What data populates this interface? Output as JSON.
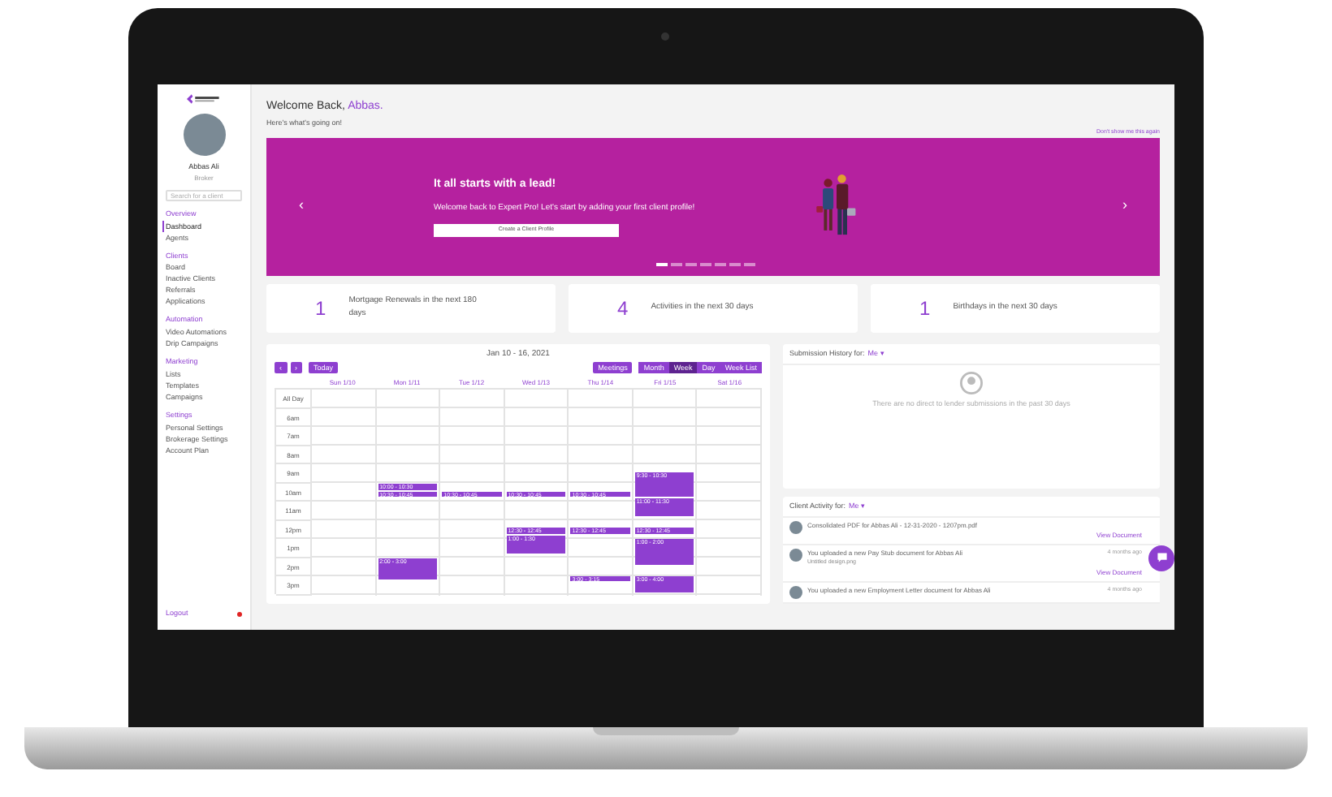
{
  "sidebar": {
    "user": {
      "name": "Abbas Ali",
      "role": "Broker"
    },
    "search": {
      "placeholder": "Search for a client"
    },
    "sections": [
      {
        "title": "Overview",
        "items": [
          {
            "label": "Dashboard",
            "selected": true
          },
          {
            "label": "Agents",
            "selected": false
          }
        ]
      },
      {
        "title": "Clients",
        "items": [
          {
            "label": "Board",
            "selected": false
          },
          {
            "label": "Inactive Clients",
            "selected": false
          },
          {
            "label": "Referrals",
            "selected": false
          },
          {
            "label": "Applications",
            "selected": false
          }
        ]
      },
      {
        "title": "Automation",
        "items": [
          {
            "label": "Video Automations",
            "selected": false
          },
          {
            "label": "Drip Campaigns",
            "selected": false
          }
        ]
      },
      {
        "title": "Marketing",
        "items": [
          {
            "label": "Lists",
            "selected": false
          },
          {
            "label": "Templates",
            "selected": false
          },
          {
            "label": "Campaigns",
            "selected": false
          }
        ]
      },
      {
        "title": "Settings",
        "items": [
          {
            "label": "Personal Settings",
            "selected": false
          },
          {
            "label": "Brokerage Settings",
            "selected": false
          },
          {
            "label": "Account Plan",
            "selected": false
          }
        ]
      }
    ],
    "logout": "Logout"
  },
  "header": {
    "greeting": "Welcome Back,",
    "name": "Abbas.",
    "subtitle": "Here's what's going on!",
    "dismiss_link": "Don't show me this again"
  },
  "banner": {
    "prev": "‹",
    "next": "›",
    "title": "It all starts with a lead!",
    "text": "Welcome back to Expert Pro! Let's start by adding your first client profile!",
    "button": "Create a Client Profile",
    "dots": [
      {
        "selected": true
      },
      {
        "selected": false
      },
      {
        "selected": false
      },
      {
        "selected": false
      },
      {
        "selected": false
      },
      {
        "selected": false
      },
      {
        "selected": false
      }
    ]
  },
  "stats": [
    {
      "value": "1",
      "label": "Mortgage Renewals in the next 180 days"
    },
    {
      "value": "4",
      "label": "Activities in the next 30 days"
    },
    {
      "value": "1",
      "label": "Birthdays in the next 30 days"
    }
  ],
  "calendar": {
    "title": "Jan 10 - 16, 2021",
    "nav": [
      "‹",
      "›"
    ],
    "today": "Today",
    "filter": "Meetings",
    "views": [
      {
        "label": "Month",
        "selected": false
      },
      {
        "label": "Week",
        "selected": true
      },
      {
        "label": "Day",
        "selected": false
      },
      {
        "label": "Week List",
        "selected": false
      }
    ],
    "all_day": "All Day",
    "hours": [
      "6am",
      "7am",
      "8am",
      "9am",
      "10am",
      "11am",
      "12pm",
      "1pm",
      "2pm",
      "3pm"
    ],
    "days": [
      {
        "label": "Sun 1/10"
      },
      {
        "label": "Mon 1/11",
        "events": [
          {
            "time": "10:00 - 10:30"
          },
          {
            "time": "10:30 - 10:45"
          },
          {
            "time": "2:00 - 3:00"
          }
        ]
      },
      {
        "label": "Tue 1/12",
        "events": [
          {
            "time": "10:30 - 10:45"
          }
        ]
      },
      {
        "label": "Wed 1/13",
        "events": [
          {
            "time": "10:30 - 10:45"
          },
          {
            "time": "12:30 - 12:45"
          },
          {
            "time": "1:00 - 1:30"
          }
        ]
      },
      {
        "label": "Thu 1/14",
        "events": [
          {
            "time": "10:30 - 10:45"
          },
          {
            "time": "12:30 - 12:45"
          },
          {
            "time": "3:00 - 3:15"
          }
        ]
      },
      {
        "label": "Fri 1/15",
        "events": [
          {
            "time": "9:30 - 10:30"
          },
          {
            "time": "11:00 - 11:30"
          },
          {
            "time": "12:30 - 12:45"
          },
          {
            "time": "1:00 - 2:00"
          },
          {
            "time": "3:00 - 4:00"
          }
        ]
      },
      {
        "label": "Sat 1/16"
      }
    ]
  },
  "submissions": {
    "title": "Submission History for:",
    "filter": "Me ▾",
    "empty": "There are no direct to lender submissions in the past 30 days"
  },
  "activity": {
    "title": "Client Activity for:",
    "filter": "Me ▾",
    "items": [
      {
        "text": "Consolidated PDF for Abbas Ali - 12-31-2020 - 1207pm.pdf",
        "link": "View Document"
      },
      {
        "text": "You uploaded a new Pay Stub document for Abbas Ali",
        "detail": "Untitled design.png",
        "time": "4 months ago",
        "link": "View Document"
      },
      {
        "text": "You uploaded a new Employment Letter document for Abbas Ali",
        "time": "4 months ago"
      }
    ]
  }
}
